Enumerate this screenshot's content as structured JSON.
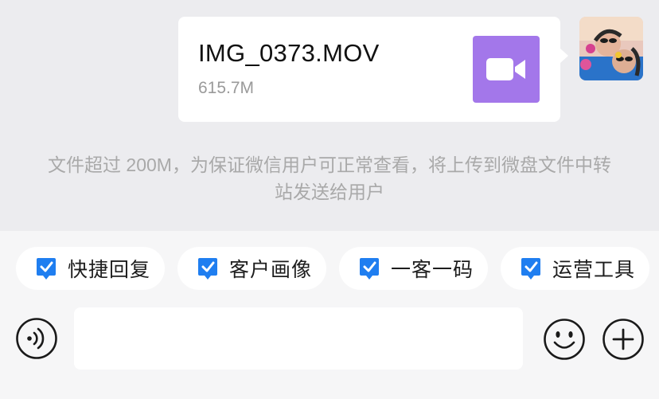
{
  "message": {
    "file_name": "IMG_0373.MOV",
    "file_size": "615.7M",
    "file_icon": "video-camera-icon"
  },
  "system_notice": "文件超过 200M，为保证微信用户可正常查看，将上传到微盘文件中转站发送给用户",
  "toolbar": {
    "chips": [
      {
        "label": "快捷回复",
        "icon": "check-square-icon"
      },
      {
        "label": "客户画像",
        "icon": "check-square-icon"
      },
      {
        "label": "一客一码",
        "icon": "check-square-icon"
      },
      {
        "label": "运营工具",
        "icon": "check-square-icon"
      }
    ]
  },
  "input": {
    "value": "",
    "placeholder": ""
  },
  "colors": {
    "video_thumb": "#a377ea",
    "chip_check": "#1f7ef0",
    "background": "#ececef"
  }
}
